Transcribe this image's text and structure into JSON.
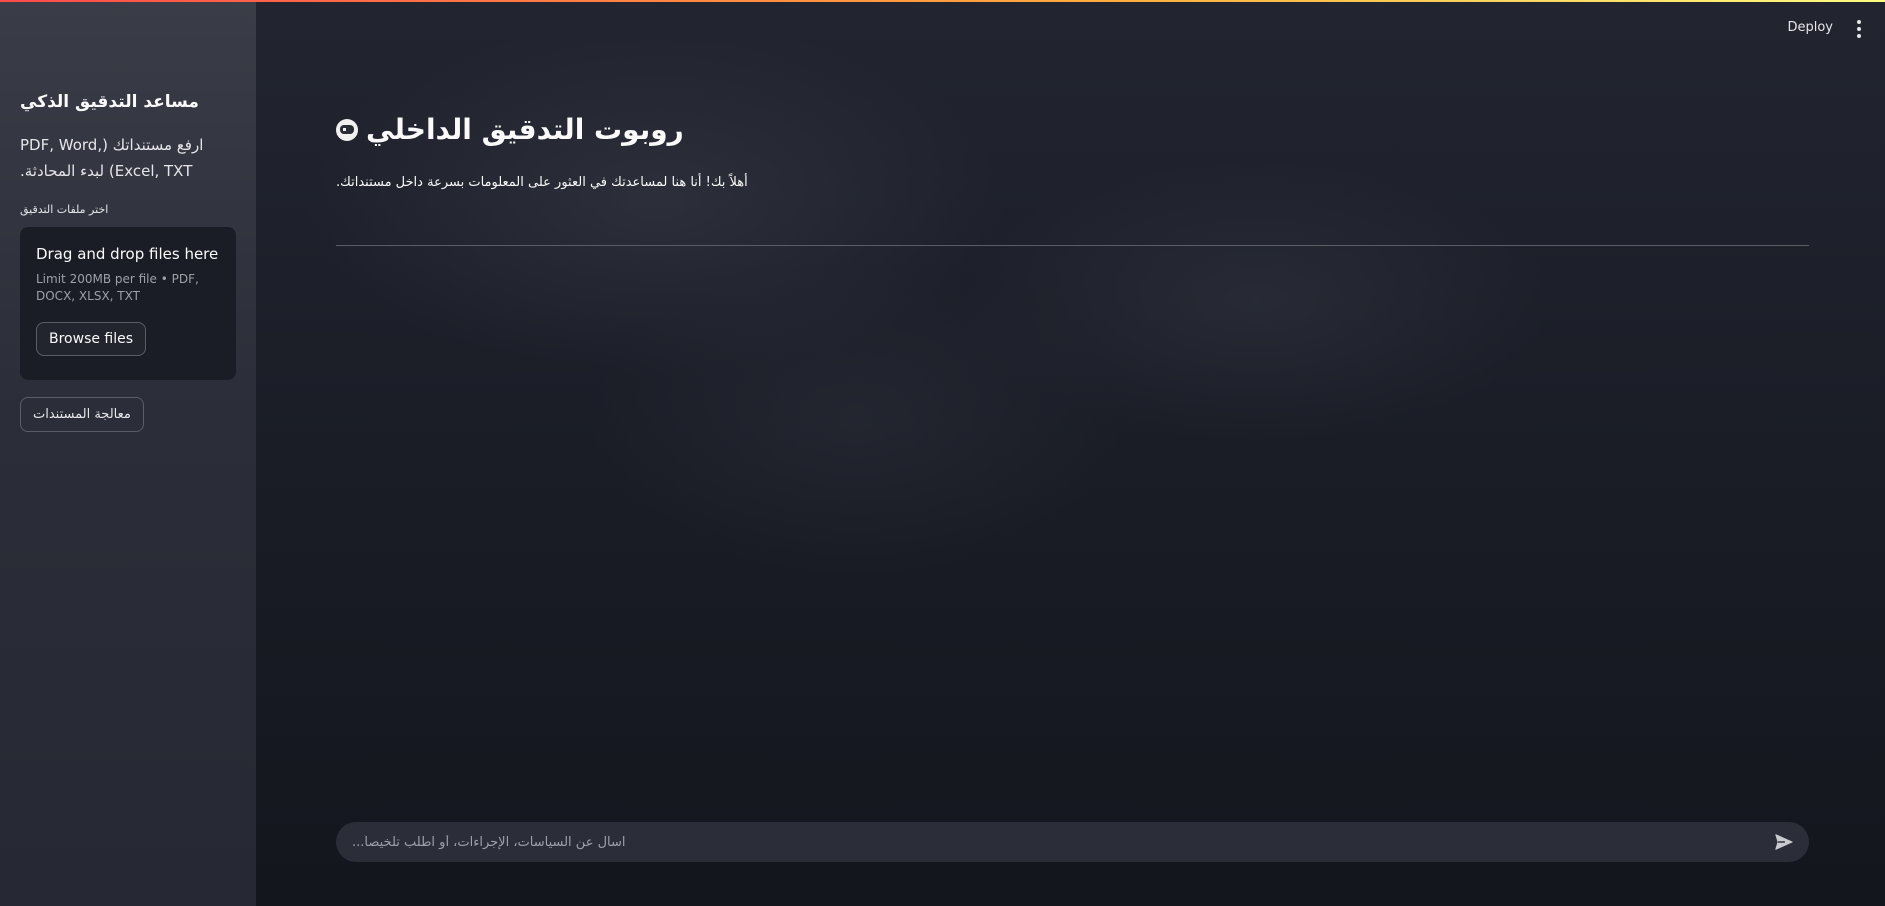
{
  "header": {
    "deploy_label": "Deploy",
    "menu_icon": "vertical-dots-icon"
  },
  "sidebar": {
    "title": "مساعد التدقيق الذكي",
    "description": "ارفع مستنداتك (PDF, Word, Excel, TXT) لبدء المحادثة.",
    "uploader": {
      "label": "اختر ملفات التدقيق",
      "drop_title": "Drag and drop files here",
      "limit_text": "Limit 200MB per file • PDF, DOCX, XLSX, TXT",
      "browse_label": "Browse files"
    },
    "process_label": "معالجة المستندات"
  },
  "main": {
    "title": "روبوت التدقيق الداخلي",
    "title_icon": "robot-face-icon",
    "subtitle": "أهلاً بك! أنا هنا لمساعدتك في العثور على المعلومات بسرعة داخل مستنداتك.",
    "chat": {
      "placeholder": "اسأل عن السياسات، الإجراءات، أو اطلب تلخيصاً...",
      "send_icon": "send-icon"
    }
  },
  "colors": {
    "accent_gradient_start": "#ff4b4b",
    "accent_gradient_end": "#fffd80",
    "sidebar_bg": "#2b2e38",
    "main_bg": "#1a1d26"
  }
}
